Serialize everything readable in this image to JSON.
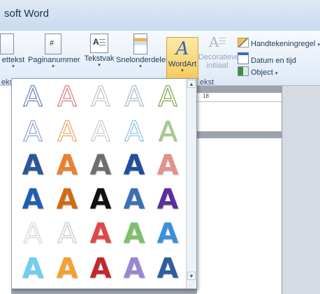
{
  "window": {
    "title": "soft Word"
  },
  "ribbon": {
    "buttons": [
      {
        "label": "ettekst",
        "icon": "page-icon"
      },
      {
        "label": "Paginanummer",
        "icon": "page-number-icon"
      },
      {
        "label": "Tekstvak",
        "icon": "textbox-icon"
      },
      {
        "label": "Snelonderdelen",
        "icon": "quickparts-icon"
      },
      {
        "label": "WordArt",
        "icon": "wordart-icon"
      },
      {
        "label": "Decoratieve",
        "label2": "initiaal",
        "icon": "dropcap-icon"
      }
    ],
    "small_buttons": [
      {
        "label": "Handtekeningregel",
        "icon": "signature-line-icon"
      },
      {
        "label": "Datum en tijd",
        "icon": "date-time-icon"
      },
      {
        "label": "Object",
        "icon": "object-icon"
      }
    ],
    "group_labels": {
      "left": "eks",
      "right": "ekst"
    }
  },
  "ruler": {
    "marker": "18"
  },
  "wordart_gallery": {
    "glyph": "A",
    "rows": [
      [
        "#6a82b8",
        "#d97b7b",
        "#bfc5cc",
        "#a9b8cf",
        "#7aa84a"
      ],
      [
        "#8fa5d3",
        "#f0a55a",
        "#c8ccd2",
        "#8fc3e0",
        "#a6c98a"
      ],
      [
        "#2f5597",
        "#e8822e",
        "#6e6e6e",
        "#1f4e9c",
        "#e3908e"
      ],
      [
        "#1f5fb0",
        "#d46a12",
        "#111111",
        "#3d6fb6",
        "#5b2f9a"
      ],
      [
        "#d0d3d8",
        "#c4c7cc",
        "#e04848",
        "#7ec06a",
        "#3c8fd9"
      ],
      [
        "#6ecff0",
        "#f5a030",
        "#c0282c",
        "#9a86d0",
        "#2e5e9e"
      ]
    ]
  }
}
